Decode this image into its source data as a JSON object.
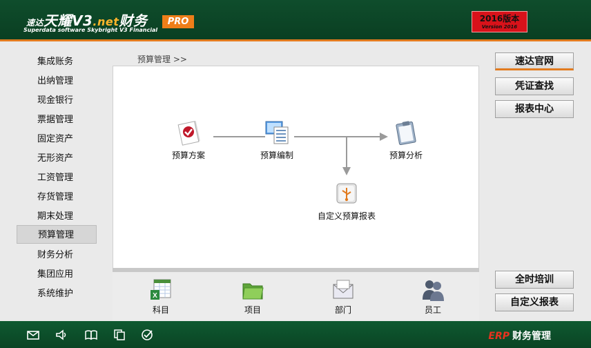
{
  "header": {
    "logo_prefix": "速达",
    "logo_main": "天耀V3",
    "logo_net": ".net",
    "logo_suffix": "财务",
    "logo_subtitle": "Superdata software Skybright V3 Financial",
    "edition_badge": "PRO",
    "version_line1": "2016版本",
    "version_line2": "Version 2016"
  },
  "sidebar": {
    "items": [
      {
        "label": "集成账务"
      },
      {
        "label": "出纳管理"
      },
      {
        "label": "现金银行"
      },
      {
        "label": "票据管理"
      },
      {
        "label": "固定资产"
      },
      {
        "label": "无形资产"
      },
      {
        "label": "工资管理"
      },
      {
        "label": "存货管理"
      },
      {
        "label": "期末处理"
      },
      {
        "label": "预算管理"
      },
      {
        "label": "财务分析"
      },
      {
        "label": "集团应用"
      },
      {
        "label": "系统维护"
      }
    ],
    "active_index": 9
  },
  "breadcrumb": "预算管理 >>",
  "flow": {
    "plan": "预算方案",
    "edit": "预算编制",
    "analysis": "预算分析",
    "custom_report": "自定义预算报表"
  },
  "bottom": {
    "account": "科目",
    "project": "项目",
    "department": "部门",
    "employee": "员工"
  },
  "right_buttons": {
    "website": "速达官网",
    "voucher_search": "凭证查找",
    "report_center": "报表中心",
    "training": "全时培训",
    "custom_report": "自定义报表"
  },
  "footer": {
    "brand_erp": "ERP",
    "brand_text": "财务管理",
    "icons": [
      "mail-icon",
      "speaker-icon",
      "book-icon",
      "copy-icon",
      "check-icon"
    ]
  },
  "colors": {
    "header_green": "#0f4d2c",
    "accent_orange": "#e27b1f",
    "version_red": "#d8121a"
  }
}
